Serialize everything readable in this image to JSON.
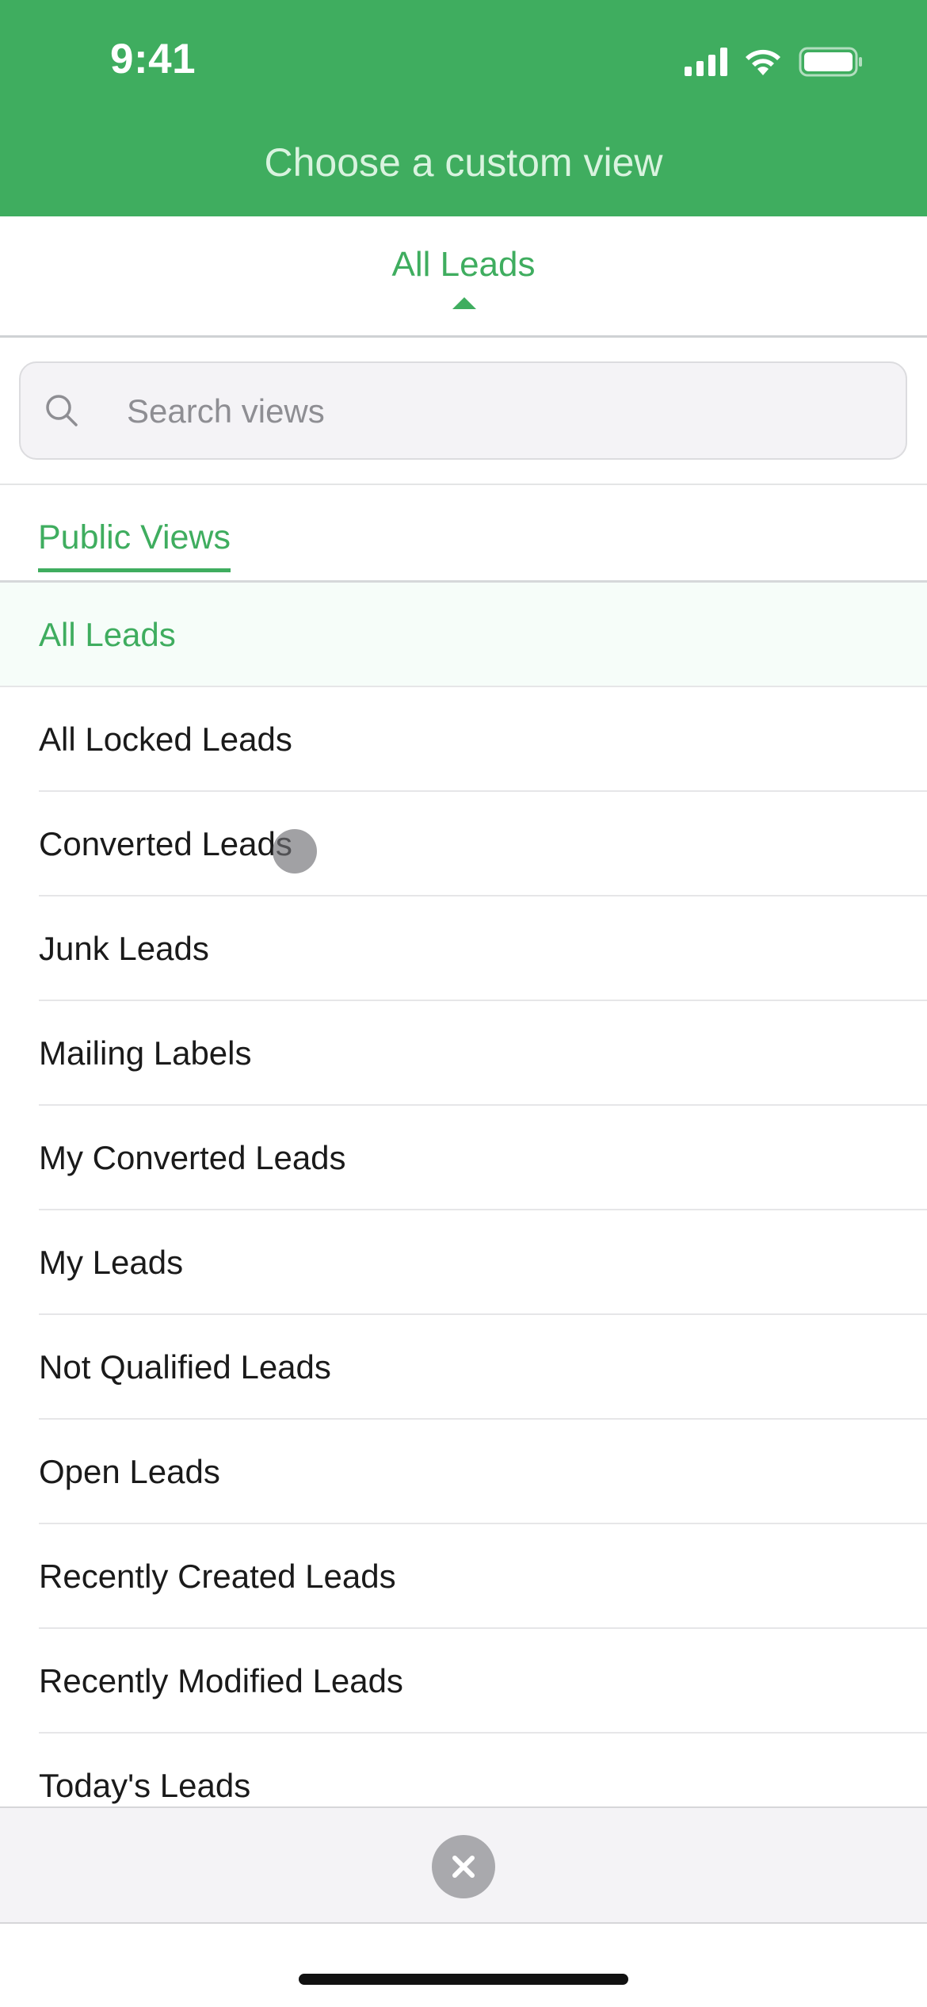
{
  "status_bar": {
    "time": "9:41",
    "icons": [
      "signal-icon",
      "wifi-icon",
      "battery-icon"
    ]
  },
  "header": {
    "title": "Choose a custom view"
  },
  "current_view": {
    "label": "All Leads"
  },
  "search": {
    "placeholder": "Search views",
    "value": ""
  },
  "section_tab": {
    "label": "Public Views"
  },
  "views": [
    {
      "label": "All Leads",
      "selected": true
    },
    {
      "label": "All Locked Leads",
      "selected": false
    },
    {
      "label": "Converted Leads",
      "selected": false
    },
    {
      "label": "Junk Leads",
      "selected": false
    },
    {
      "label": "Mailing Labels",
      "selected": false
    },
    {
      "label": "My Converted Leads",
      "selected": false
    },
    {
      "label": "My Leads",
      "selected": false
    },
    {
      "label": "Not Qualified Leads",
      "selected": false
    },
    {
      "label": "Open Leads",
      "selected": false
    },
    {
      "label": "Recently Created Leads",
      "selected": false
    },
    {
      "label": "Recently Modified Leads",
      "selected": false
    },
    {
      "label": "Today's Leads",
      "selected": false
    }
  ],
  "colors": {
    "accent": "#3fad5f",
    "selected_row_bg": "#f6fdf9"
  },
  "close_icon": "close-icon"
}
